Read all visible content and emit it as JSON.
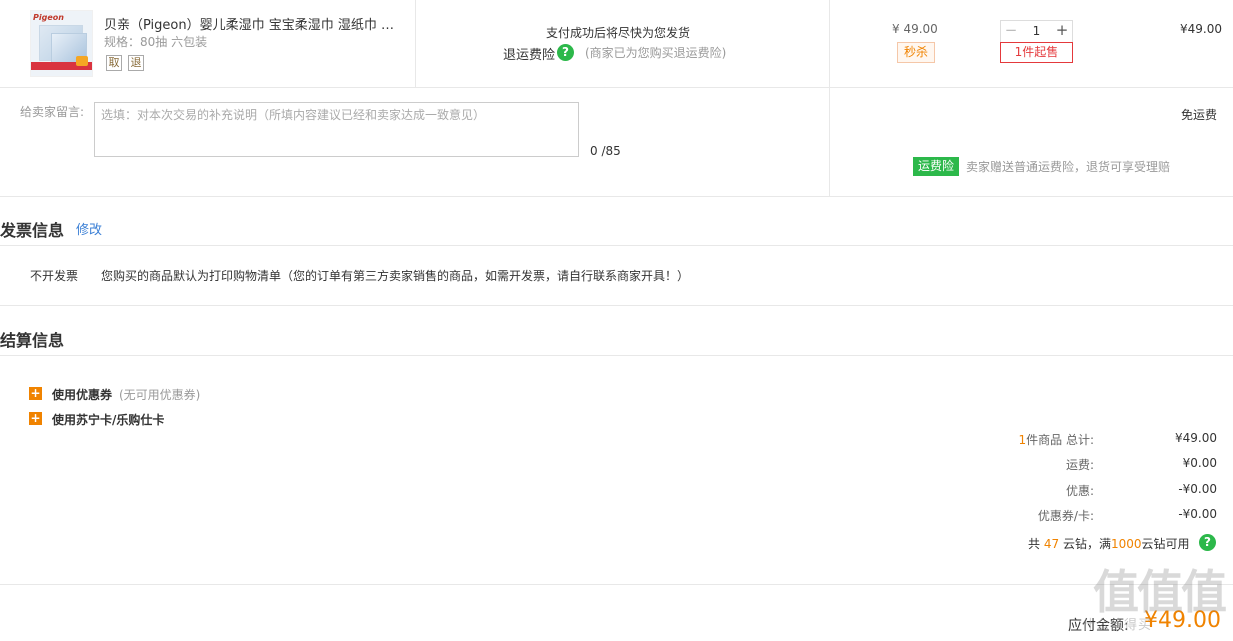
{
  "product": {
    "brand_mark": "Pigeon",
    "name": "贝亲（Pigeon）婴儿柔湿巾 宝宝柔湿巾 湿纸巾 宝...",
    "spec": "规格：80抽 六包装",
    "tag_1": "取",
    "tag_2": "退",
    "ship_note": "支付成功后将尽快为您发货",
    "ins_label": "退运费险",
    "ins_note": "(商家已为您购买退运费险)",
    "price": "¥ 49.00",
    "flash_badge": "秒杀",
    "qty_minus": "−",
    "qty": "1",
    "qty_plus": "+",
    "min_badge": "1件起售",
    "row_total": "¥49.00"
  },
  "message": {
    "label": "给卖家留言:",
    "placeholder": "选填：对本次交易的补充说明（所填内容建议已经和卖家达成一致意见）",
    "count": "0 /85",
    "free_ship": "免运费",
    "ins_badge": "运费险",
    "ins_desc": "卖家赠送普通运费险，退货可享受理赔"
  },
  "invoice": {
    "title": "发票信息",
    "edit": "修改",
    "type": "不开发票",
    "desc": "您购买的商品默认为打印购物清单（您的订单有第三方卖家销售的商品，如需开发票，请自行联系商家开具！）"
  },
  "settlement": {
    "title": "结算信息",
    "coupon_label": "使用优惠券",
    "coupon_note": "(无可用优惠券)",
    "card_label": "使用苏宁卡/乐购仕卡",
    "items_count": "1",
    "items_label": "件商品 总计:",
    "items_total": "¥49.00",
    "shipping_label": "运费:",
    "shipping_val": "¥0.00",
    "discount_label": "优惠:",
    "discount_val": "-¥0.00",
    "coupon_card_label": "优惠券/卡:",
    "coupon_card_val": "-¥0.00",
    "points_prefix": "共",
    "points_count": "47",
    "points_mid": "云钻，满",
    "points_threshold": "1000",
    "points_suffix": "云钻可用",
    "due_label": "应付金额:",
    "due_val": "¥49.00"
  },
  "icons": {
    "help": "?",
    "plus": "+"
  },
  "watermark": {
    "text": "值值值",
    "sub": "什么值得买"
  },
  "colors": {
    "accent_orange": "#f08300",
    "insurance_green": "#2cb84a",
    "alert_red": "#e4393c",
    "link_blue": "#3a7fd5"
  }
}
